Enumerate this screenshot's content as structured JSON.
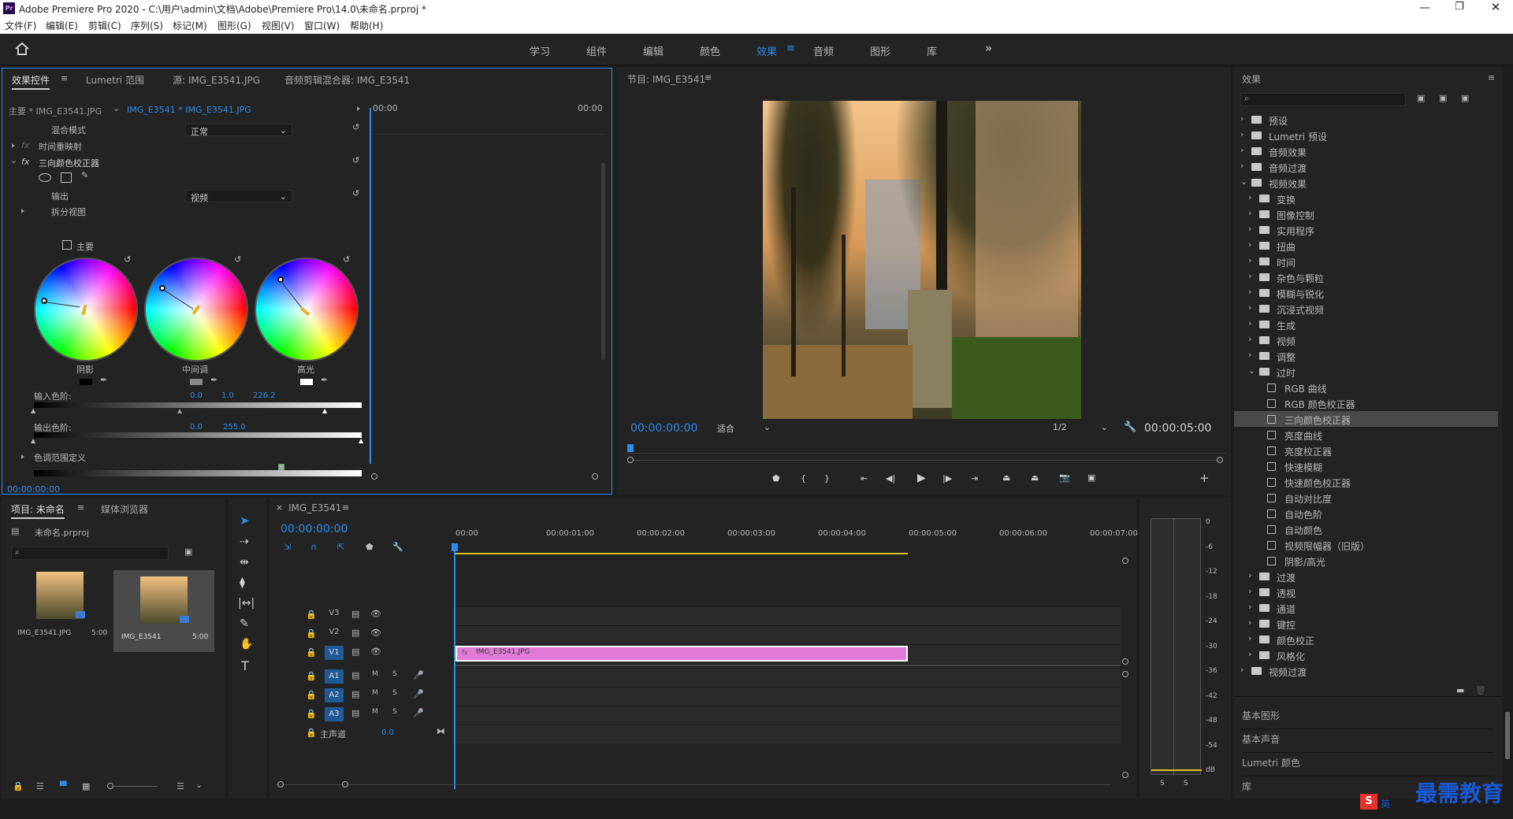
{
  "app": {
    "title": "Adobe Premiere Pro 2020 - C:\\用户\\admin\\文档\\Adobe\\Premiere Pro\\14.0\\未命名.prproj *",
    "logo": "Pr"
  },
  "menu": [
    "文件(F)",
    "编辑(E)",
    "剪辑(C)",
    "序列(S)",
    "标记(M)",
    "图形(G)",
    "视图(V)",
    "窗口(W)",
    "帮助(H)"
  ],
  "workspaces": [
    "学习",
    "组件",
    "编辑",
    "颜色",
    "效果",
    "音频",
    "图形",
    "库"
  ],
  "workspace_active": "效果",
  "effect_controls": {
    "tabs": [
      "效果控件",
      "Lumetri 范围",
      "源: IMG_E3541.JPG",
      "音频剪辑混合器: IMG_E3541"
    ],
    "master": "主要 * IMG_E3541.JPG",
    "clip": "IMG_E3541 * IMG_E3541.JPG",
    "time_start": "00:00",
    "time_end": "00:00",
    "blend_label": "混合模式",
    "blend_value": "正常",
    "time_remap": "时间重映射",
    "effect_name": "三向颜色校正器",
    "output_label": "输出",
    "output_value": "视频",
    "split_view": "拆分视图",
    "master_chk": "主要",
    "wheels": [
      "阴影",
      "中间调",
      "高光"
    ],
    "input_levels_label": "输入色阶:",
    "input_levels": [
      "0.0",
      "1.0",
      "226.2"
    ],
    "output_levels_label": "输出色阶:",
    "output_levels": [
      "0.0",
      "255.0"
    ],
    "tonal_range": "色调范围定义",
    "timecode": "00:00:00:00"
  },
  "program": {
    "title": "节目: IMG_E3541",
    "timecode": "00:00:00:00",
    "fit": "适合",
    "res": "1/2",
    "duration": "00:00:05:00"
  },
  "effects_panel": {
    "title": "效果",
    "items": [
      {
        "label": "预设",
        "level": 0,
        "open": false
      },
      {
        "label": "Lumetri 预设",
        "level": 0,
        "open": false
      },
      {
        "label": "音频效果",
        "level": 0,
        "open": false
      },
      {
        "label": "音频过渡",
        "level": 0,
        "open": false
      },
      {
        "label": "视频效果",
        "level": 0,
        "open": true
      },
      {
        "label": "变换",
        "level": 1,
        "open": false
      },
      {
        "label": "图像控制",
        "level": 1,
        "open": false
      },
      {
        "label": "实用程序",
        "level": 1,
        "open": false
      },
      {
        "label": "扭曲",
        "level": 1,
        "open": false
      },
      {
        "label": "时间",
        "level": 1,
        "open": false
      },
      {
        "label": "杂色与颗粒",
        "level": 1,
        "open": false
      },
      {
        "label": "模糊与锐化",
        "level": 1,
        "open": false
      },
      {
        "label": "沉浸式视频",
        "level": 1,
        "open": false
      },
      {
        "label": "生成",
        "level": 1,
        "open": false
      },
      {
        "label": "视频",
        "level": 1,
        "open": false
      },
      {
        "label": "调整",
        "level": 1,
        "open": false
      },
      {
        "label": "过时",
        "level": 1,
        "open": true
      },
      {
        "label": "RGB 曲线",
        "level": 2,
        "fx": true
      },
      {
        "label": "RGB 颜色校正器",
        "level": 2,
        "fx": true
      },
      {
        "label": "三向颜色校正器",
        "level": 2,
        "fx": true,
        "selected": true
      },
      {
        "label": "亮度曲线",
        "level": 2,
        "fx": true
      },
      {
        "label": "亮度校正器",
        "level": 2,
        "fx": true
      },
      {
        "label": "快速模糊",
        "level": 2,
        "fx": true
      },
      {
        "label": "快速颜色校正器",
        "level": 2,
        "fx": true
      },
      {
        "label": "自动对比度",
        "level": 2,
        "fx": true
      },
      {
        "label": "自动色阶",
        "level": 2,
        "fx": true
      },
      {
        "label": "自动颜色",
        "level": 2,
        "fx": true
      },
      {
        "label": "视频限幅器（旧版）",
        "level": 2,
        "fx": true
      },
      {
        "label": "阴影/高光",
        "level": 2,
        "fx": true
      },
      {
        "label": "过渡",
        "level": 1,
        "open": false
      },
      {
        "label": "透视",
        "level": 1,
        "open": false
      },
      {
        "label": "通道",
        "level": 1,
        "open": false
      },
      {
        "label": "键控",
        "level": 1,
        "open": false
      },
      {
        "label": "颜色校正",
        "level": 1,
        "open": false
      },
      {
        "label": "风格化",
        "level": 1,
        "open": false
      },
      {
        "label": "视频过渡",
        "level": 0,
        "open": false
      }
    ],
    "sections": [
      "基本图形",
      "基本声音",
      "Lumetri 颜色",
      "库"
    ]
  },
  "project": {
    "tabs": [
      "项目: 未命名",
      "媒体浏览器"
    ],
    "file": "未命名.prproj",
    "items": [
      {
        "name": "IMG_E3541.JPG",
        "dur": "5:00"
      },
      {
        "name": "IMG_E3541",
        "dur": "5:00"
      }
    ]
  },
  "timeline": {
    "tab": "IMG_E3541",
    "timecode": "00:00:00:00",
    "ruler": [
      "00:00",
      "00:00:01:00",
      "00:00:02:00",
      "00:00:03:00",
      "00:00:04:00",
      "00:00:05:00",
      "00:00:06:00",
      "00:00:07:00"
    ],
    "video_tracks": [
      "V3",
      "V2",
      "V1"
    ],
    "audio_tracks": [
      "A1",
      "A2",
      "A3"
    ],
    "master_label": "主声道",
    "master_value": "0.0",
    "clip": "IMG_E3541.JPG",
    "clip_color": "#e07ad6"
  },
  "meter": {
    "scale": [
      "0",
      "-6",
      "-12",
      "-18",
      "-24",
      "-30",
      "-36",
      "-42",
      "-48",
      "-54",
      "dB"
    ],
    "solo": [
      "S",
      "S"
    ]
  },
  "watermark": {
    "text": "最需教育",
    "ime": "英"
  },
  "colors": {
    "accent": "#2d8ceb",
    "clip": "#e07ad6",
    "panel": "#232323"
  }
}
